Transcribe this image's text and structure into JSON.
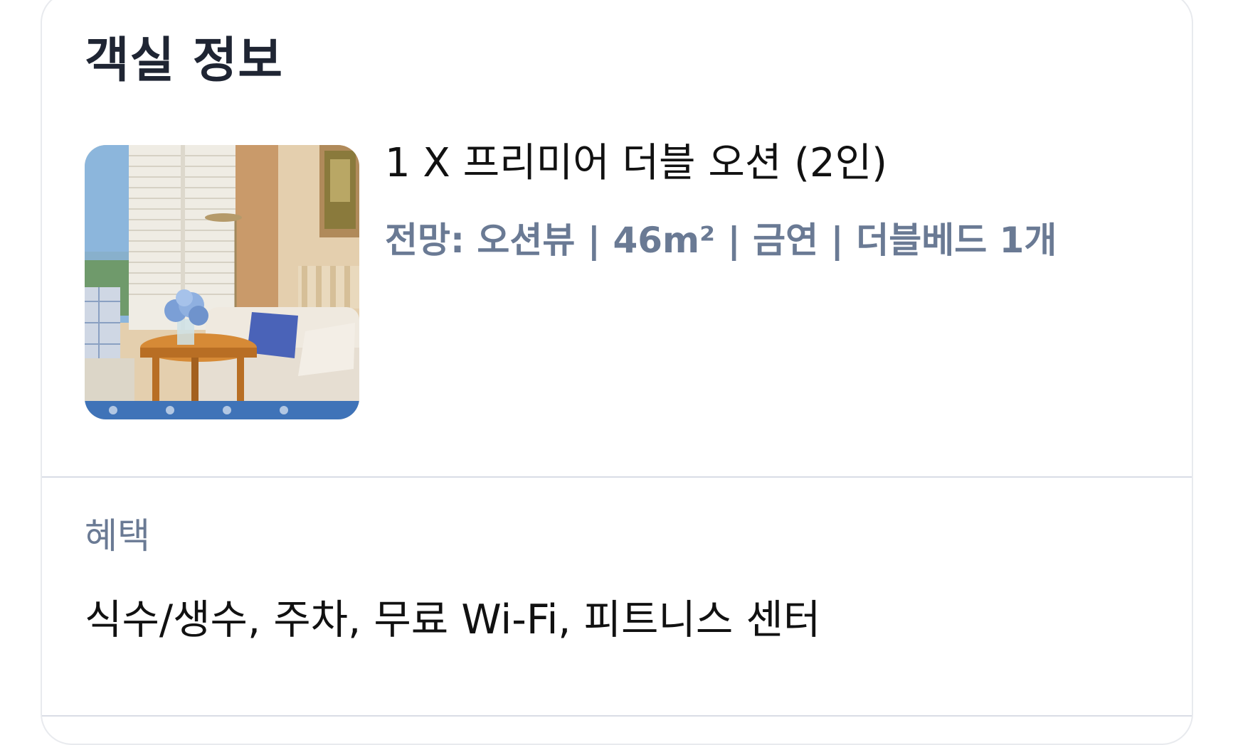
{
  "room_info": {
    "title": "객실 정보",
    "room_name": "1 X 프리미어 더블 오션 (2인)",
    "room_specs": "전망: 오션뷰 | 46m² | 금연 | 더블베드 1개",
    "photo_icon": "room-photo"
  },
  "benefits": {
    "label": "혜택",
    "value": "식수/생수, 주차, 무료 Wi-Fi, 피트니스 센터"
  },
  "colors": {
    "title": "#1f2533",
    "muted": "#6a7a94",
    "text": "#111111",
    "divider": "#d9dde6"
  }
}
